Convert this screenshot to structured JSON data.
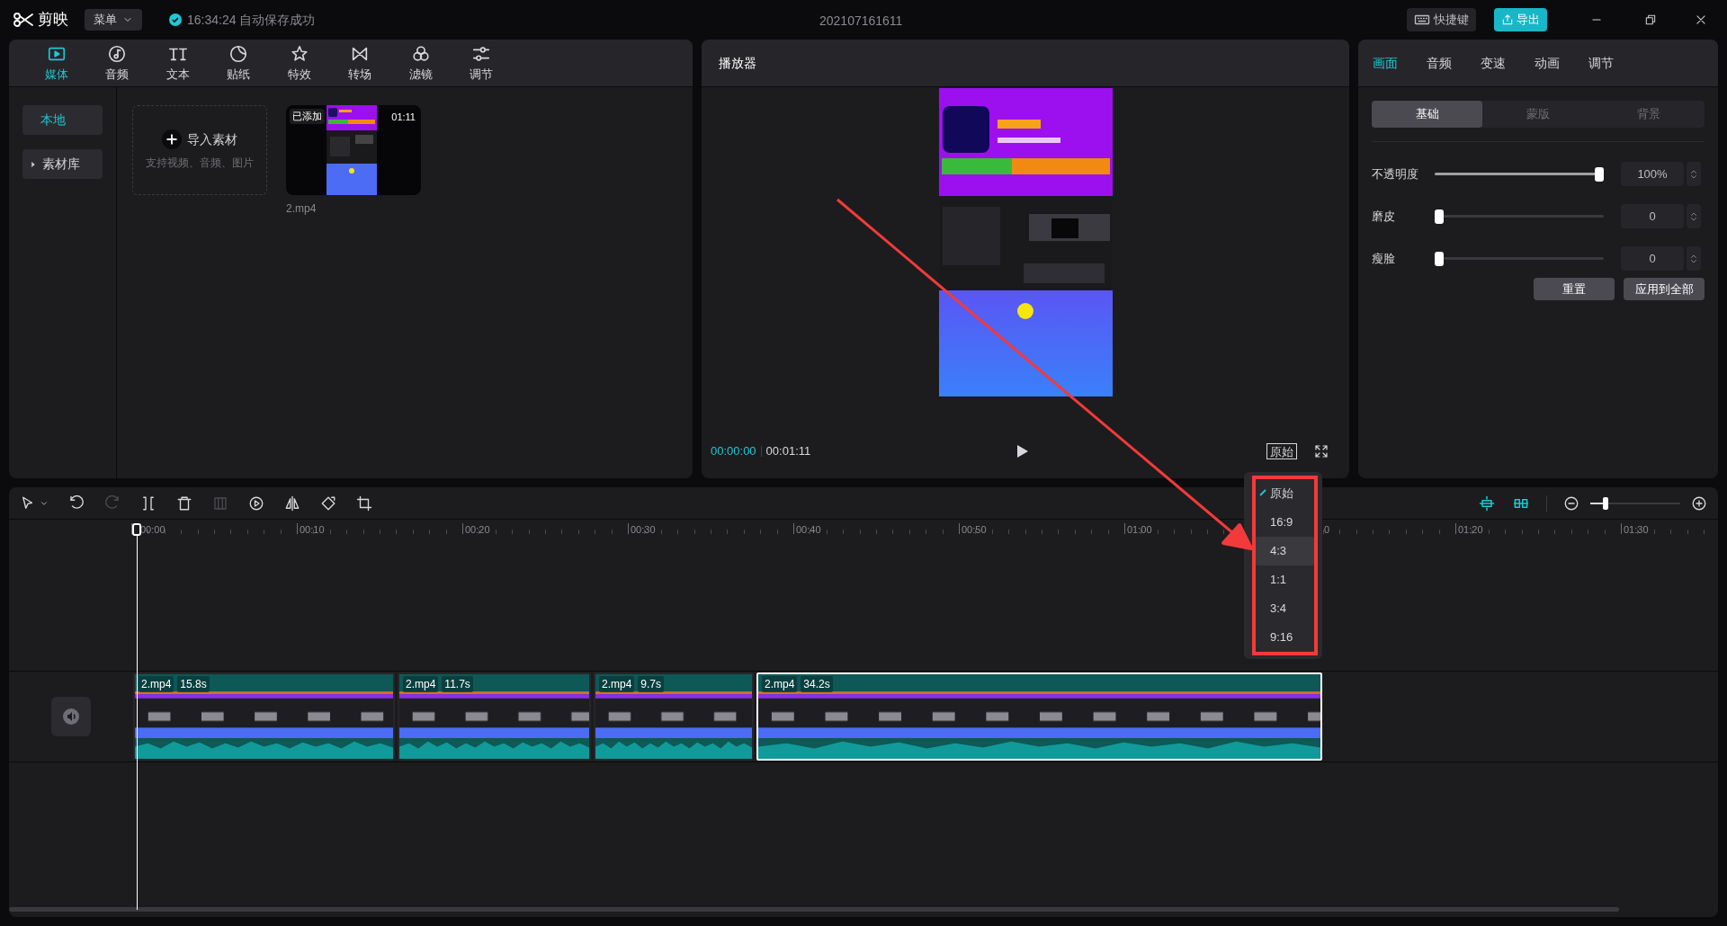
{
  "app": {
    "name": "剪映",
    "menu": "菜单",
    "save_status": "16:34:24 自动保存成功",
    "project_title": "202107161611",
    "shortcut_button": "快捷键",
    "export_button": "导出"
  },
  "media_panel": {
    "tabs": [
      {
        "label": "媒体",
        "selected": true
      },
      {
        "label": "音频",
        "selected": false
      },
      {
        "label": "文本",
        "selected": false
      },
      {
        "label": "贴纸",
        "selected": false
      },
      {
        "label": "特效",
        "selected": false
      },
      {
        "label": "转场",
        "selected": false
      },
      {
        "label": "滤镜",
        "selected": false
      },
      {
        "label": "调节",
        "selected": false
      }
    ],
    "nav": [
      {
        "label": "本地",
        "selected": true,
        "kind": "plain"
      },
      {
        "label": "素材库",
        "selected": false,
        "kind": "folder"
      }
    ],
    "import": {
      "label": "导入素材",
      "hint": "支持视频、音频、图片"
    },
    "items": [
      {
        "name": "2.mp4",
        "badge": "已添加",
        "duration": "01:11"
      }
    ]
  },
  "player": {
    "title": "播放器",
    "current_time": "00:00:00",
    "total_time": "00:01:11",
    "ratio_button": "原始"
  },
  "inspector": {
    "tabs": [
      {
        "label": "画面",
        "selected": true
      },
      {
        "label": "音频",
        "selected": false
      },
      {
        "label": "变速",
        "selected": false
      },
      {
        "label": "动画",
        "selected": false
      },
      {
        "label": "调节",
        "selected": false
      }
    ],
    "subtabs": [
      {
        "label": "基础",
        "selected": true
      },
      {
        "label": "蒙版",
        "selected": false
      },
      {
        "label": "背景",
        "selected": false
      }
    ],
    "sliders": [
      {
        "label": "不透明度",
        "level": 1,
        "value": "100%"
      },
      {
        "label": "磨皮",
        "level": 0,
        "value": "0"
      },
      {
        "label": "瘦脸",
        "level": 0,
        "value": "0"
      }
    ],
    "buttons": [
      "重置",
      "应用到全部"
    ]
  },
  "timeline": {
    "tools": [
      {
        "disabled": false
      },
      {
        "disabled": false
      },
      {
        "disabled": true
      },
      {
        "disabled": false
      },
      {
        "disabled": false
      },
      {
        "disabled": true
      },
      {
        "disabled": false
      },
      {
        "disabled": false
      },
      {
        "disabled": false
      },
      {
        "disabled": false
      }
    ],
    "zoom": {
      "level": 0.17
    },
    "ruler": [
      {
        "label": "00:00"
      },
      {
        "label": "00:10"
      },
      {
        "label": "00:20"
      },
      {
        "label": "00:30"
      },
      {
        "label": "00:40"
      },
      {
        "label": "00:50"
      },
      {
        "label": "01:00"
      },
      {
        "label": "0",
        "kind": "clipped"
      },
      {
        "label": "01:20"
      },
      {
        "label": "01:30"
      }
    ],
    "clips": [
      {
        "name": "2.mp4",
        "duration": "15.8s",
        "selected": false
      },
      {
        "name": "2.mp4",
        "duration": "11.7s",
        "selected": false
      },
      {
        "name": "2.mp4",
        "duration": "9.7s",
        "selected": false
      },
      {
        "name": "2.mp4",
        "duration": "34.2s",
        "selected": true
      }
    ]
  },
  "ratio_menu": [
    {
      "label": "原始",
      "selected": true,
      "hovered": false
    },
    {
      "label": "16:9",
      "selected": false,
      "hovered": false
    },
    {
      "label": "4:3",
      "selected": false,
      "hovered": true
    },
    {
      "label": "1:1",
      "selected": false,
      "hovered": false
    },
    {
      "label": "3:4",
      "selected": false,
      "hovered": false
    },
    {
      "label": "9:16",
      "selected": false,
      "hovered": false
    }
  ]
}
